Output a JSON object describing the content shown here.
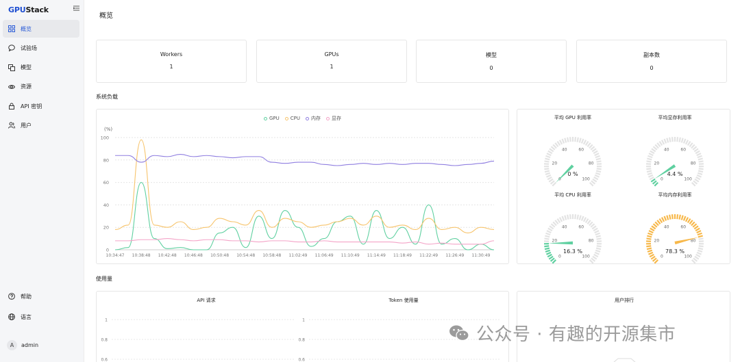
{
  "app": {
    "logo_primary": "GPU",
    "logo_secondary": "Stack",
    "page_title": "概览"
  },
  "sidebar": {
    "items": [
      {
        "label": "概览",
        "icon": "grid-icon",
        "active": true
      },
      {
        "label": "试验场",
        "icon": "chat-icon"
      },
      {
        "label": "模型",
        "icon": "copy-icon"
      },
      {
        "label": "资源",
        "icon": "eye-icon"
      },
      {
        "label": "API 密钥",
        "icon": "lock-icon"
      },
      {
        "label": "用户",
        "icon": "users-icon"
      }
    ],
    "bottom": [
      {
        "label": "帮助",
        "icon": "help-icon"
      },
      {
        "label": "语言",
        "icon": "globe-icon"
      }
    ],
    "user": {
      "initial": "A",
      "name": "admin"
    }
  },
  "stats": [
    {
      "label": "Workers",
      "value": "1"
    },
    {
      "label": "GPUs",
      "value": "1"
    },
    {
      "label": "模型",
      "value": "0"
    },
    {
      "label": "副本数",
      "value": "0"
    }
  ],
  "sections": {
    "system_load": "系统负载",
    "usage": "使用量"
  },
  "colors": {
    "gpu": "#5fd0a0",
    "cpu": "#f7c46c",
    "mem": "#8f7ee0",
    "vram": "#f4a3c7",
    "accent": "#2a5bd7"
  },
  "load_chart": {
    "legend": [
      "GPU",
      "CPU",
      "内存",
      "显存"
    ],
    "unit": "(%)",
    "y_ticks": [
      "100",
      "80",
      "60",
      "40",
      "20",
      "0"
    ],
    "x_ticks": [
      "10:34:47",
      "10:38:48",
      "10:42:48",
      "10:46:48",
      "10:50:48",
      "10:54:48",
      "10:58:48",
      "11:02:49",
      "11:06:49",
      "11:10:49",
      "11:14:49",
      "11:18:49",
      "11:22:49",
      "11:26:49",
      "11:30:49"
    ]
  },
  "chart_data": {
    "type": "line",
    "ylim": [
      0,
      100
    ],
    "x": [
      "10:34:47",
      "10:36:47",
      "10:38:48",
      "10:40:48",
      "10:42:48",
      "10:44:48",
      "10:46:48",
      "10:48:48",
      "10:50:48",
      "10:52:48",
      "10:54:48",
      "10:56:48",
      "10:58:48",
      "11:00:48",
      "11:02:49",
      "11:04:49",
      "11:06:49",
      "11:08:49",
      "11:10:49",
      "11:12:49",
      "11:14:49",
      "11:16:49",
      "11:18:49",
      "11:20:49",
      "11:22:49",
      "11:24:49",
      "11:26:49",
      "11:28:49",
      "11:30:49",
      "11:32:49"
    ],
    "series": [
      {
        "name": "GPU",
        "values": [
          0,
          2,
          60,
          10,
          1,
          2,
          0,
          0,
          15,
          20,
          2,
          30,
          10,
          35,
          20,
          3,
          10,
          25,
          30,
          5,
          35,
          10,
          20,
          5,
          40,
          5,
          10,
          0,
          5,
          0
        ]
      },
      {
        "name": "CPU",
        "values": [
          18,
          22,
          98,
          22,
          20,
          25,
          18,
          20,
          28,
          25,
          22,
          35,
          20,
          28,
          25,
          20,
          22,
          25,
          28,
          22,
          30,
          20,
          22,
          18,
          28,
          18,
          20,
          15,
          20,
          18
        ]
      },
      {
        "name": "内存",
        "values": [
          84,
          84,
          78,
          84,
          83,
          85,
          83,
          84,
          83,
          82,
          83,
          83,
          78,
          77,
          78,
          78,
          76,
          75,
          76,
          77,
          76,
          77,
          76,
          77,
          77,
          76,
          75,
          76,
          77,
          79
        ]
      },
      {
        "name": "显存",
        "values": [
          8,
          8,
          9,
          9,
          10,
          9,
          8,
          9,
          9,
          8,
          8,
          7,
          8,
          8,
          7,
          7,
          8,
          7,
          7,
          7,
          7,
          7,
          6,
          7,
          5,
          6,
          5,
          5,
          5,
          8
        ]
      }
    ]
  },
  "gauges": [
    {
      "title": "平均 GPU 利用率",
      "value": 0,
      "display": "0 %",
      "color": "#5fd0a0"
    },
    {
      "title": "平均显存利用率",
      "value": 4.4,
      "display": "4.4 %",
      "color": "#5fd0a0"
    },
    {
      "title": "平均 CPU 利用率",
      "value": 16.3,
      "display": "16.3 %",
      "color": "#5fd0a0"
    },
    {
      "title": "平均内存利用率",
      "value": 78.3,
      "display": "78.3 %",
      "color": "#f7b84a"
    }
  ],
  "gauge_ticks": [
    "0",
    "20",
    "40",
    "60",
    "80",
    "100"
  ],
  "usage": {
    "api_title": "API 请求",
    "token_title": "Token 使用量",
    "rank_title": "用户排行",
    "y_ticks": [
      "1",
      "0.8",
      "0.6"
    ]
  },
  "watermark": {
    "text": "公众号 · 有趣的开源集市"
  }
}
